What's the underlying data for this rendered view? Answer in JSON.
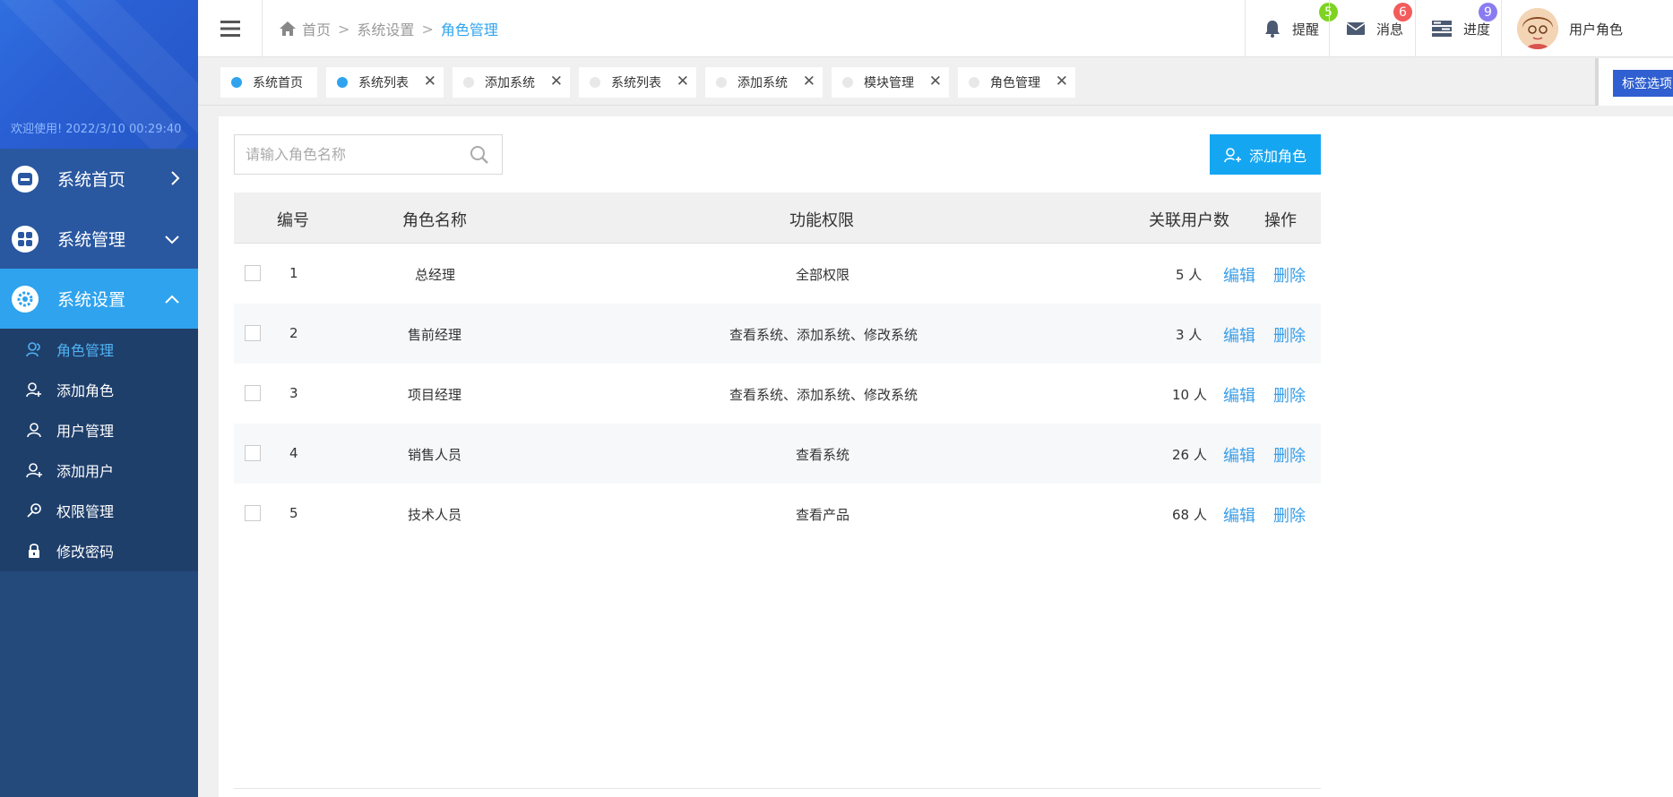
{
  "sidebar": {
    "welcome_label": "欢迎使用!",
    "welcome_time": "2022/3/10 00:29:40",
    "menu": [
      {
        "label": "系统首页",
        "icon": "box-icon",
        "arrow": "right"
      },
      {
        "label": "系统管理",
        "icon": "grid-icon",
        "arrow": "down"
      },
      {
        "label": "系统设置",
        "icon": "gear-icon",
        "arrow": "up"
      }
    ],
    "submenu": [
      {
        "label": "角色管理",
        "icon": "users-icon",
        "active": true
      },
      {
        "label": "添加角色",
        "icon": "user-add-icon"
      },
      {
        "label": "用户管理",
        "icon": "user-icon"
      },
      {
        "label": "添加用户",
        "icon": "user-plus-icon"
      },
      {
        "label": "权限管理",
        "icon": "key-icon"
      },
      {
        "label": "修改密码",
        "icon": "lock-icon"
      }
    ]
  },
  "header": {
    "breadcrumb": [
      "首页",
      "系统设置",
      "角色管理"
    ],
    "items": [
      {
        "label": "提醒",
        "badge": "5",
        "badge_color": "#7ed321",
        "icon": "bell-icon"
      },
      {
        "label": "消息",
        "badge": "6",
        "badge_color": "#f25c5c",
        "icon": "mail-icon"
      },
      {
        "label": "进度",
        "badge": "9",
        "badge_color": "#8a7cf0",
        "icon": "progress-icon"
      }
    ],
    "user_label": "用户角色"
  },
  "tabs": [
    {
      "label": "系统首页",
      "active": true,
      "closable": false
    },
    {
      "label": "系统列表",
      "active": true,
      "closable": true
    },
    {
      "label": "添加系统",
      "active": false,
      "closable": true
    },
    {
      "label": "系统列表",
      "active": false,
      "closable": true
    },
    {
      "label": "添加系统",
      "active": false,
      "closable": true
    },
    {
      "label": "模块管理",
      "active": false,
      "closable": true
    },
    {
      "label": "角色管理",
      "active": false,
      "closable": true
    }
  ],
  "tabs_options_label": "标签选项",
  "search": {
    "placeholder": "请输入角色名称",
    "value": ""
  },
  "add_button_label": "添加角色",
  "table": {
    "headers": [
      "编号",
      "角色名称",
      "功能权限",
      "关联用户数",
      "操作"
    ],
    "rows": [
      {
        "id": "1",
        "name": "总经理",
        "perm": "全部权限",
        "users": "5 人"
      },
      {
        "id": "2",
        "name": "售前经理",
        "perm": "查看系统、添加系统、修改系统",
        "users": "3 人"
      },
      {
        "id": "3",
        "name": "项目经理",
        "perm": "查看系统、添加系统、修改系统",
        "users": "10 人"
      },
      {
        "id": "4",
        "name": "销售人员",
        "perm": "查看系统",
        "users": "26 人"
      },
      {
        "id": "5",
        "name": "技术人员",
        "perm": "查看产品",
        "users": "68 人"
      }
    ],
    "edit_label": "编辑",
    "delete_label": "删除"
  },
  "colors": {
    "accent": "#2fa3ee",
    "sidebar": "#244a7c",
    "add_button": "#15a6f2"
  }
}
